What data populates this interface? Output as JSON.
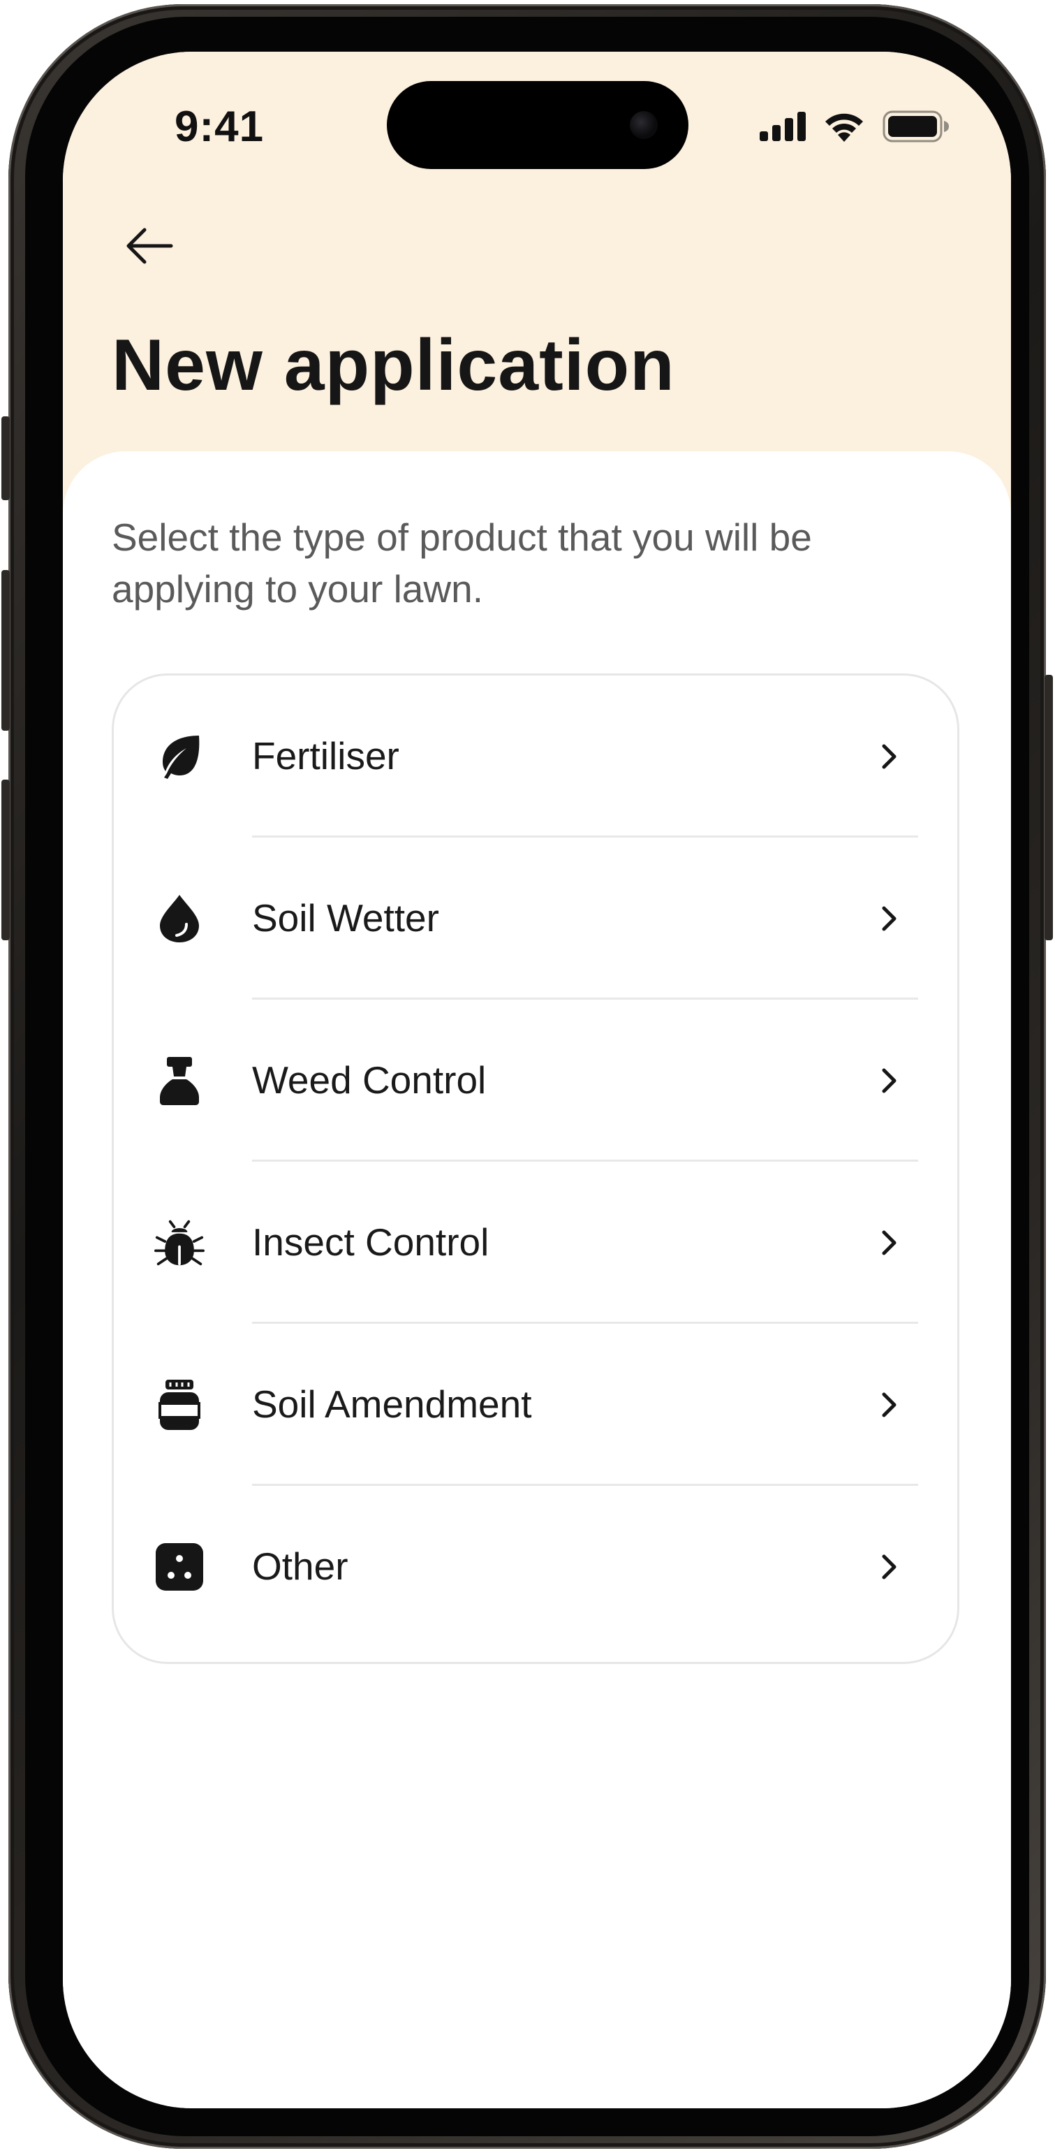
{
  "status_bar": {
    "time": "9:41"
  },
  "header": {
    "title": "New application",
    "back_icon": "arrow-left-icon"
  },
  "content": {
    "description": "Select the type of product that you will be applying to your lawn."
  },
  "product_types": [
    {
      "label": "Fertiliser",
      "icon": "leaf-icon"
    },
    {
      "label": "Soil Wetter",
      "icon": "water-drop-icon"
    },
    {
      "label": "Weed Control",
      "icon": "spray-bottle-icon"
    },
    {
      "label": "Insect Control",
      "icon": "bug-icon"
    },
    {
      "label": "Soil Amendment",
      "icon": "jar-icon"
    },
    {
      "label": "Other",
      "icon": "dice-icon"
    }
  ],
  "colors": {
    "header_background": "#fcf0df",
    "text_primary": "#161616",
    "text_secondary": "#5a5a5a",
    "card_border": "#e6e6e6"
  }
}
